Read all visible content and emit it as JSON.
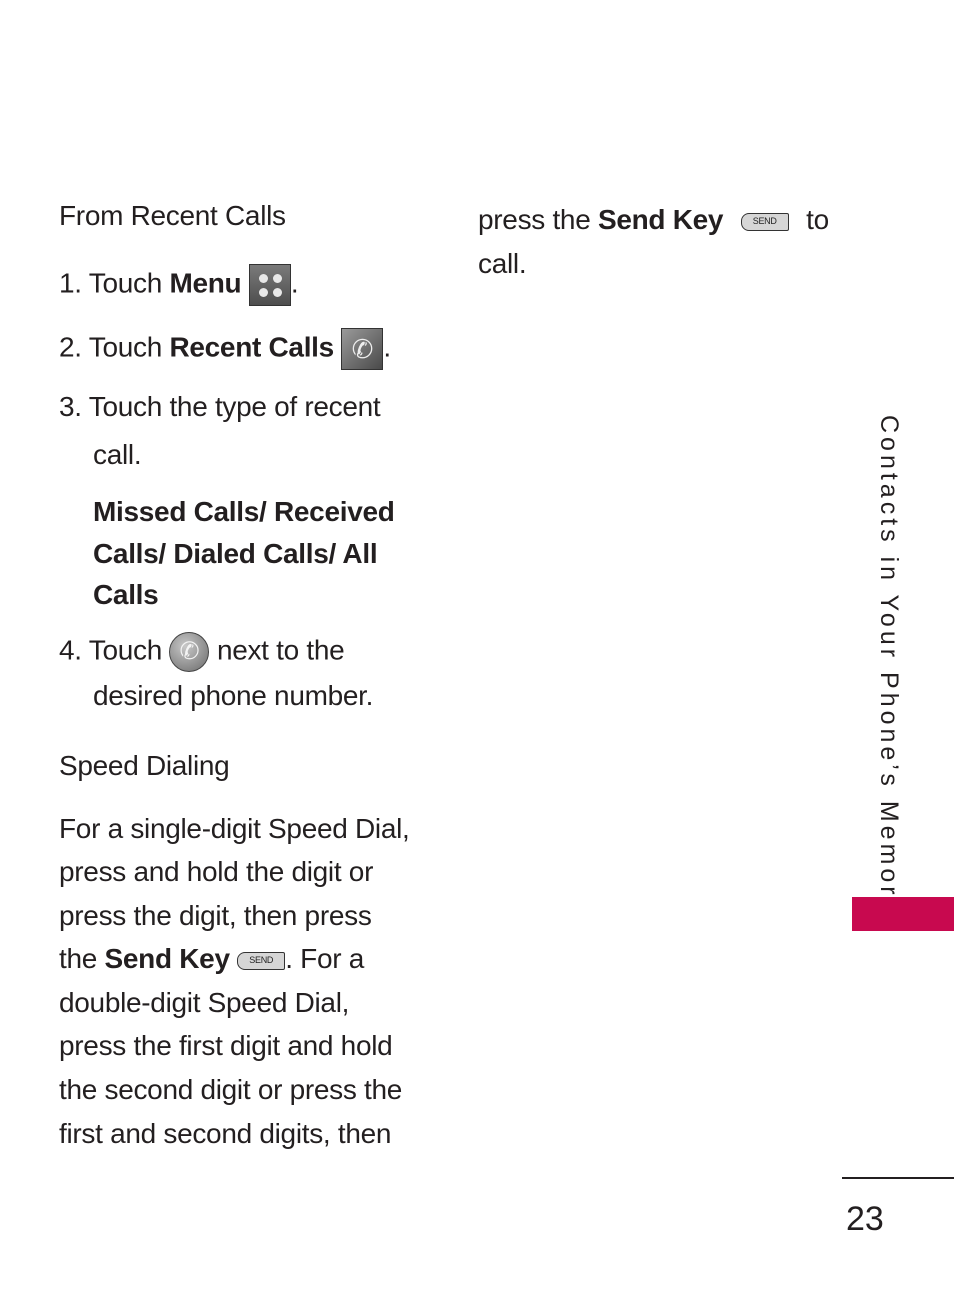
{
  "left_column": {
    "section1_heading": "From Recent Calls",
    "step1": {
      "num": "1.",
      "pre": "Touch",
      "bold": "Menu",
      "icon": "menu-grid-icon",
      "post": "."
    },
    "step2": {
      "num": "2.",
      "pre": "Touch",
      "bold": "Recent Calls",
      "icon": "recent-calls-icon",
      "post": "."
    },
    "step3": {
      "num": "3.",
      "line1": "Touch the type of recent",
      "line2": "call."
    },
    "options": [
      "Missed Calls/ Received",
      "Calls/ Dialed Calls/ All",
      "Calls"
    ],
    "step4": {
      "num": "4.",
      "pre": "Touch",
      "icon": "call-icon",
      "post": "next to the",
      "line2": "desired phone number."
    },
    "section2_heading": "Speed Dialing",
    "para": {
      "l1": "For a single-digit Speed Dial,",
      "l2": "press and hold the digit or",
      "l3": "press the digit, then press",
      "l4_pre": "the",
      "l4_bold": "Send Key",
      "l4_post": ". For a",
      "l5": "double-digit Speed Dial,",
      "l6": "press the first digit and hold",
      "l7": "the second digit or press the",
      "l8": "first and second digits, then"
    }
  },
  "right_column": {
    "l1_pre": "press the",
    "l1_bold": "Send Key",
    "l1_post": "to",
    "l2": "call."
  },
  "send_key_label": "SEND",
  "side_tab": {
    "text": "Contacts in Your Phone’s Memory",
    "color": "#c8094f"
  },
  "page_number": "23"
}
